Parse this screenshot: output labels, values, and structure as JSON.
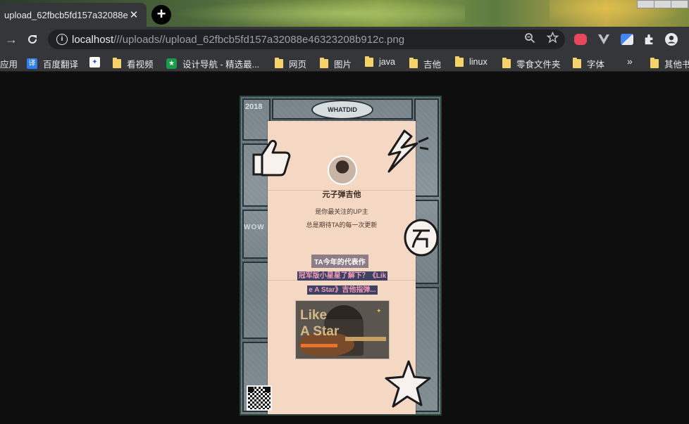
{
  "tab": {
    "title": "upload_62fbcb5fd157a32088e",
    "close": "✕",
    "new_tab": "+"
  },
  "toolbar": {
    "back": "→",
    "reload": "C",
    "info": "i",
    "url_host": "localhost",
    "url_path": "///uploads//upload_62fbcb5fd157a32088e46323208b912c.png"
  },
  "bookmarks": [
    {
      "label": "应用",
      "kind": "apps"
    },
    {
      "label": "百度翻译",
      "kind": "translate"
    },
    {
      "label": "",
      "kind": "baidu"
    },
    {
      "label": "看视频",
      "kind": "folder"
    },
    {
      "label": "设计导航 - 精选最...",
      "kind": "site"
    },
    {
      "label": "网页",
      "kind": "folder"
    },
    {
      "label": "图片",
      "kind": "folder"
    },
    {
      "label": "java",
      "kind": "folder"
    },
    {
      "label": "吉他",
      "kind": "folder"
    },
    {
      "label": "linux",
      "kind": "folder"
    },
    {
      "label": "零食文件夹",
      "kind": "folder"
    },
    {
      "label": "字体",
      "kind": "folder"
    },
    {
      "label": "»",
      "kind": "more"
    },
    {
      "label": "其他书",
      "kind": "folder"
    }
  ],
  "poster": {
    "year": "2018",
    "speech": "WHATDID",
    "side_text": "WOW",
    "creator_name": "元子弹吉他",
    "tagline_1": "是你最关注的UP主",
    "tagline_2": "总是期待TA的每一次更新",
    "work_label": "TA今年的代表作",
    "work_title_1": "冠军版小星星了解下？《Lik",
    "work_title_2": "e A Star》吉他指弹...",
    "thumb_word_1": "Like",
    "thumb_word_2": "A Star"
  },
  "colors": {
    "tab_bg": "#35363a",
    "page_bg": "#0e0e0e",
    "paper": "#f5d8c3",
    "title_pink": "#f59ab8",
    "title_bg": "#3b4262"
  }
}
